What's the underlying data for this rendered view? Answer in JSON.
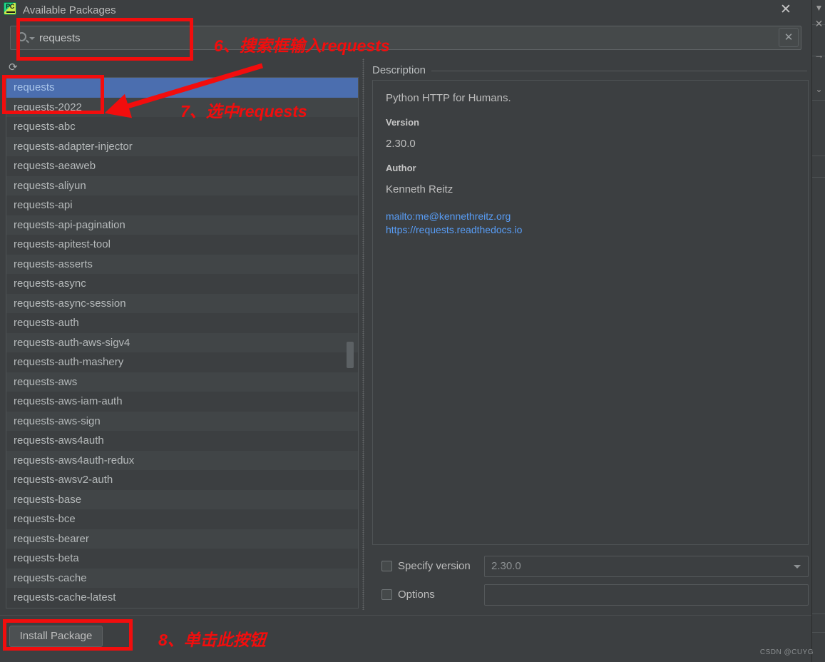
{
  "window": {
    "title": "Available Packages",
    "app_icon": "pycharm-icon",
    "close_icon": "close-icon"
  },
  "search": {
    "value": "requests",
    "placeholder": "Search",
    "icon": "search-icon",
    "dropdown_icon": "chevron-down-icon",
    "clear_icon": "clear-icon"
  },
  "list": {
    "refresh_icon": "refresh-icon",
    "selected_index": 0,
    "items": [
      "requests",
      "requests-2022",
      "requests-abc",
      "requests-adapter-injector",
      "requests-aeaweb",
      "requests-aliyun",
      "requests-api",
      "requests-api-pagination",
      "requests-apitest-tool",
      "requests-asserts",
      "requests-async",
      "requests-async-session",
      "requests-auth",
      "requests-auth-aws-sigv4",
      "requests-auth-mashery",
      "requests-aws",
      "requests-aws-iam-auth",
      "requests-aws-sign",
      "requests-aws4auth",
      "requests-aws4auth-redux",
      "requests-awsv2-auth",
      "requests-base",
      "requests-bce",
      "requests-bearer",
      "requests-beta",
      "requests-cache",
      "requests-cache-latest"
    ]
  },
  "description": {
    "section_title": "Description",
    "summary": "Python HTTP for Humans.",
    "version_label": "Version",
    "version_value": "2.30.0",
    "author_label": "Author",
    "author_value": "Kenneth Reitz",
    "links": [
      "mailto:me@kennethreitz.org",
      "https://requests.readthedocs.io"
    ]
  },
  "options": {
    "specify_version_label": "Specify version",
    "specify_version_checked": false,
    "specify_version_value": "2.30.0",
    "options_label": "Options",
    "options_checked": false,
    "options_value": ""
  },
  "footer": {
    "install_label": "Install Package",
    "watermark": "CSDN @CUYG"
  },
  "annotations": [
    {
      "id": "step6",
      "text": "6、搜索框输入requests"
    },
    {
      "id": "step7",
      "text": "7、选中requests"
    },
    {
      "id": "step8",
      "text": "8、单击此按钮"
    }
  ],
  "background_strip": {
    "icons": [
      "chevron-down-icon",
      "close-icon",
      "arrow-right-icon",
      "chevron-down-icon"
    ]
  },
  "colors": {
    "window_bg": "#3c3f41",
    "row_alt_bg": "#414547",
    "selection_blue": "#4b6eaf",
    "selection_text": "#a9c5ea",
    "link_blue": "#589df6",
    "annotation_red": "#f20d0d",
    "text_primary": "#bdbdbd"
  }
}
